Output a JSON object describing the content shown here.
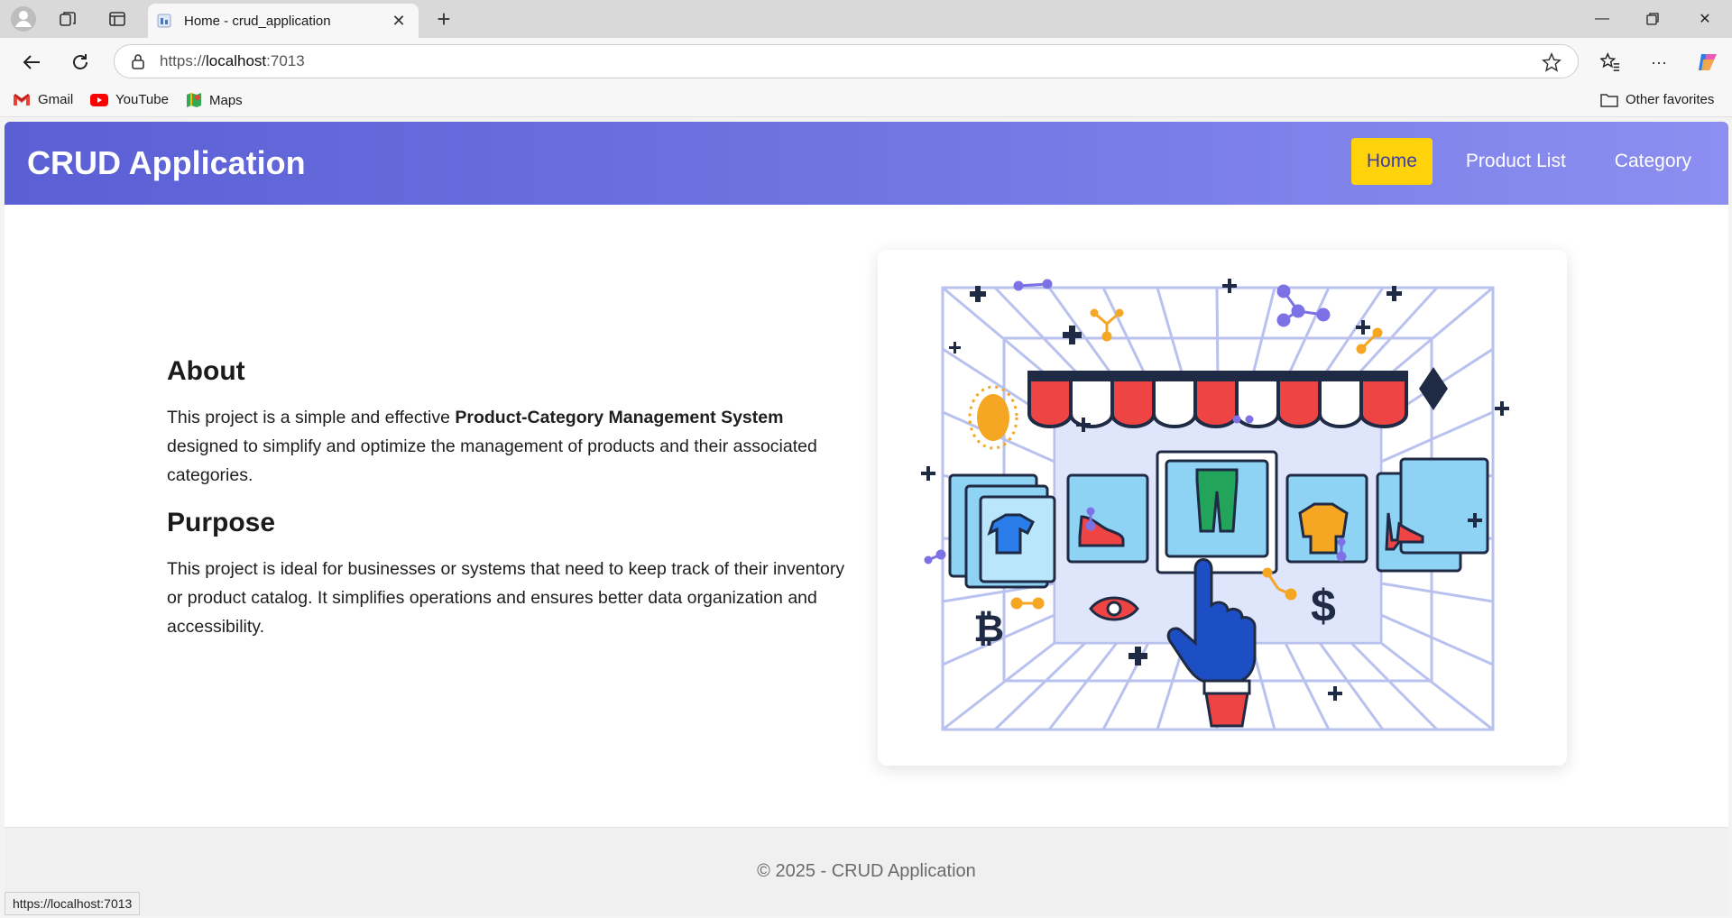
{
  "browser": {
    "tab_title": "Home - crud_application",
    "url_scheme": "https://",
    "url_host": "localhost",
    "url_port": ":7013",
    "bookmarks": [
      {
        "label": "Gmail",
        "icon": "gmail-icon"
      },
      {
        "label": "YouTube",
        "icon": "youtube-icon"
      },
      {
        "label": "Maps",
        "icon": "maps-icon"
      }
    ],
    "other_favorites": "Other favorites",
    "status_url": "https://localhost:7013"
  },
  "navbar": {
    "brand": "CRUD Application",
    "links": [
      {
        "label": "Home",
        "active": true
      },
      {
        "label": "Product List",
        "active": false
      },
      {
        "label": "Category",
        "active": false
      }
    ]
  },
  "about": {
    "heading": "About",
    "text_before": "This project is a simple and effective ",
    "text_bold": "Product-Category Management System",
    "text_after": " designed to simplify and optimize the management of products and their associated categories."
  },
  "purpose": {
    "heading": "Purpose",
    "text": "This project is ideal for businesses or systems that need to keep track of their inventory or product catalog. It simplifies operations and ensures better data organization and accessibility."
  },
  "footer": {
    "text": "© 2025 - CRUD Application"
  },
  "colors": {
    "navbar_start": "#5a5fd4",
    "navbar_end": "#8c8ff0",
    "active_link_bg": "#ffd20a",
    "awning_red": "#ef4444"
  }
}
